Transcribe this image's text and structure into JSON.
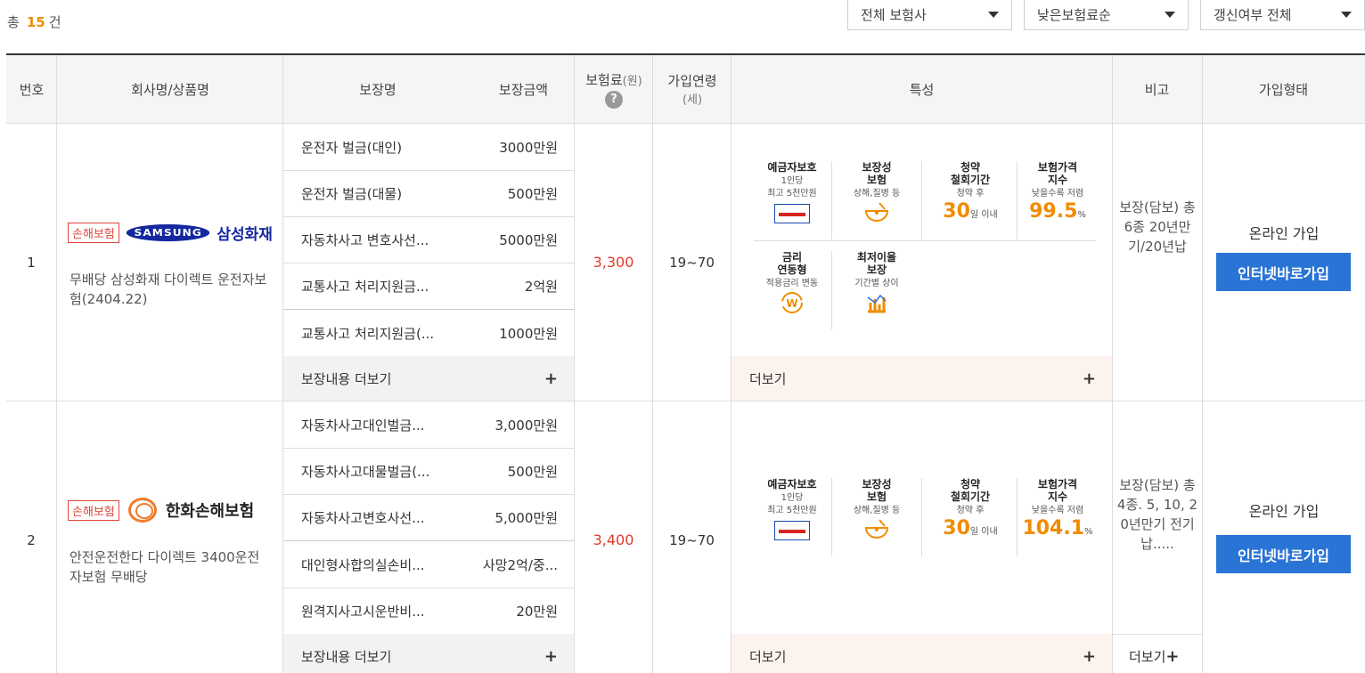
{
  "summary": {
    "prefix": "총",
    "count": "15",
    "suffix": "건"
  },
  "filters": [
    {
      "value": "전체 보험사"
    },
    {
      "value": "낮은보험료순"
    },
    {
      "value": "갱신여부 전체"
    }
  ],
  "headers": {
    "no": "번호",
    "product": "회사명/상품명",
    "coverage_name": "보장명",
    "coverage_amount": "보장금액",
    "premium": "보험료",
    "premium_unit": "(원)",
    "age": "가입연령",
    "age_unit": "(세)",
    "features": "특성",
    "note": "비고",
    "join_type": "가입형태"
  },
  "rows": [
    {
      "no": "1",
      "badge": "손해보험",
      "logo_text": "SAMSUNG",
      "brand_text": "삼성화재",
      "product_name": "무배당 삼성화재 다이렉트 운전자보험(2404.22)",
      "coverages": [
        {
          "name": "운전자 벌금(대인)",
          "amount": "3000만원"
        },
        {
          "name": "운전자 벌금(대물)",
          "amount": "500만원"
        },
        {
          "name": "자동차사고 변호사선...",
          "amount": "5000만원"
        },
        {
          "name": "교통사고 처리지원금...",
          "amount": "2억원"
        },
        {
          "name": "교통사고 처리지원금(...",
          "amount": "1000만원"
        }
      ],
      "more_coverage": "보장내용 더보기",
      "premium": "3,300",
      "age": "19~70",
      "features": {
        "deposit_title": "예금자보호",
        "deposit_sub1": "1인당",
        "deposit_sub2": "최고 5천만원",
        "protect_title1": "보장성",
        "protect_title2": "보험",
        "protect_sub": "상해,질병 등",
        "withdraw_title1": "청약",
        "withdraw_title2": "철회기간",
        "withdraw_sub": "청약 후",
        "withdraw_num": "30",
        "withdraw_unit": "일 이내",
        "price_title1": "보험가격",
        "price_title2": "지수",
        "price_sub": "낮을수록 저렴",
        "price_num": "99.5",
        "price_unit": "%",
        "rate_title1": "금리",
        "rate_title2": "연동형",
        "rate_sub": "적용금리 변동",
        "min_title1": "최저이율",
        "min_title2": "보장",
        "min_sub": "기간별 상이"
      },
      "more_features": "더보기",
      "note": "보장(담보) 총 6종 20년만기/20년납",
      "join_type": "온라인 가입",
      "join_button": "인터넷바로가입"
    },
    {
      "no": "2",
      "badge": "손해보험",
      "brand_text": "한화손해보험",
      "product_name": "안전운전한다 다이렉트 3400운전자보험 무배당",
      "coverages": [
        {
          "name": "자동차사고대인벌금...",
          "amount": "3,000만원"
        },
        {
          "name": "자동차사고대물벌금(...",
          "amount": "500만원"
        },
        {
          "name": "자동차사고변호사선...",
          "amount": "5,000만원"
        },
        {
          "name": "대인형사합의실손비...",
          "amount": "사망2억/중..."
        },
        {
          "name": "원격지사고시운반비...",
          "amount": "20만원"
        }
      ],
      "more_coverage": "보장내용 더보기",
      "premium": "3,400",
      "age": "19~70",
      "features": {
        "deposit_title": "예금자보호",
        "deposit_sub1": "1인당",
        "deposit_sub2": "최고 5천만원",
        "protect_title1": "보장성",
        "protect_title2": "보험",
        "protect_sub": "상해,질병 등",
        "withdraw_title1": "청약",
        "withdraw_title2": "철회기간",
        "withdraw_sub": "청약 후",
        "withdraw_num": "30",
        "withdraw_unit": "일 이내",
        "price_title1": "보험가격",
        "price_title2": "지수",
        "price_sub": "낮을수록 저렴",
        "price_num": "104.1",
        "price_unit": "%"
      },
      "more_features": "더보기",
      "note": "보장(담보) 총 4종. 5, 10, 20년만기 전기납.....",
      "more_note": "더보기",
      "join_type": "온라인 가입",
      "join_button": "인터넷바로가입"
    }
  ]
}
